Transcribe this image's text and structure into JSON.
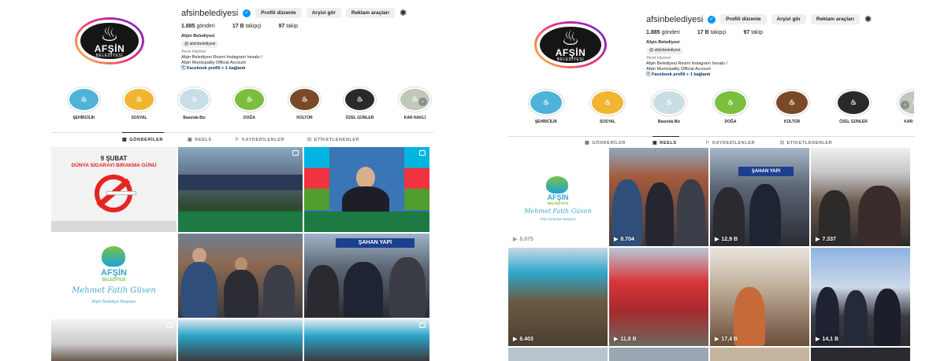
{
  "profile": {
    "username": "afsinbelediyesi",
    "edit_label": "Profili düzenle",
    "archive_label": "Arşivi gör",
    "ads_label": "Reklam araçları",
    "posts": "1.885",
    "posts_label": "gönderi",
    "followers": "17 B",
    "followers_label": "takipçi",
    "following": "97",
    "following_label": "takip",
    "full_name": "Afşin Belediyesi",
    "threads": "afsinbelediyesi",
    "category": "Yerel Hizmet",
    "bio_line1": "Afşin Belediyesi Resmi Instagram hesabı /",
    "bio_line2": "Afşin Municipality Official Account",
    "facebook": "Facebook profili + 1 bağlantı",
    "logo_brand": "AFŞİN",
    "logo_sub": "BELEDİYESİ"
  },
  "highlights": [
    {
      "label": "ŞEHİRCİLİK",
      "color": "#4fb3d9"
    },
    {
      "label": "SOSYAL",
      "color": "#f2b531"
    },
    {
      "label": "Basında Biz",
      "color": "#c9dde6"
    },
    {
      "label": "DOĞA",
      "color": "#7cbf3f"
    },
    {
      "label": "KÜLTÜR",
      "color": "#7a4a28"
    },
    {
      "label": "ÖZEL GÜNLER",
      "color": "#2a2a2a"
    },
    {
      "label": "KAR NAKLİ",
      "color": "#bfc9b8"
    }
  ],
  "tabs": [
    {
      "label": "GÖNDERİLER",
      "icon": "▦"
    },
    {
      "label": "REELS",
      "icon": "▣"
    },
    {
      "label": "KAYDEDİLENLER",
      "icon": "⚐"
    },
    {
      "label": "ETİKETLENENLER",
      "icon": "⊡"
    }
  ],
  "left_posts": {
    "smoking_date": "9 ŞUBAT",
    "smoking_title": "DÜNYA SİGARAYI BIRAKMA GÜNÜ",
    "logo_brand": "AFŞİN",
    "logo_sub": "BELEDİYESİ",
    "signature": "Mehmet Fatih Güven",
    "mayor_title": "Afşin Belediye Başkanı",
    "sign_text": "ŞAHAN YAPI"
  },
  "right_reels": [
    {
      "views": "8.675"
    },
    {
      "views": "8.704"
    },
    {
      "views": "12,9 B"
    },
    {
      "views": "7.337"
    },
    {
      "views": "6.403"
    },
    {
      "views": "11,8 B"
    },
    {
      "views": "17,4 B"
    },
    {
      "views": "14,1 B"
    }
  ],
  "right_logo": {
    "brand": "AFŞİN",
    "sub": "BELEDİYESİ",
    "signature": "Mehmet Fatih Güven",
    "title": "Afşin Belediye Başkanı"
  },
  "right_sign": "ŞAHAN YAPI",
  "colors": {
    "accent": "#0095f6",
    "red": "#e52521",
    "green": "#3fa535"
  }
}
